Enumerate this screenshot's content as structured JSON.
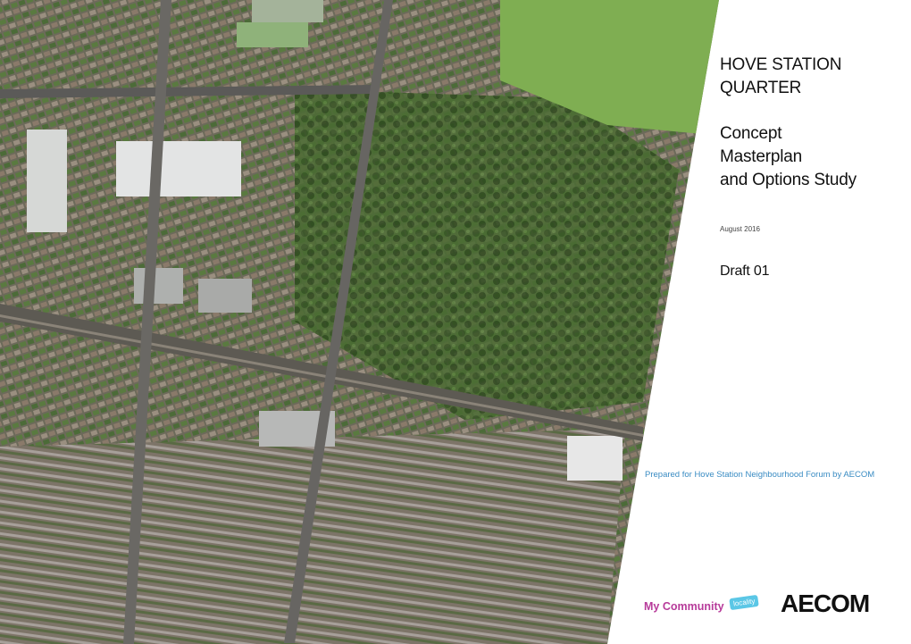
{
  "cover": {
    "title_line1": "HOVE STATION",
    "title_line2": "QUARTER",
    "subtitle_line1": "Concept",
    "subtitle_line2": "Masterplan",
    "subtitle_line3": "and Options Study",
    "date": "August 2016",
    "draft": "Draft 01",
    "credit": "Prepared for Hove Station Neighbourhood Forum by AECOM"
  },
  "logos": {
    "my_community": "My Community",
    "locality": "locality",
    "aecom": "AECOM"
  },
  "colors": {
    "credit": "#3a8cc3",
    "my_community": "#b73b9a",
    "locality": "#5bc7e6"
  }
}
